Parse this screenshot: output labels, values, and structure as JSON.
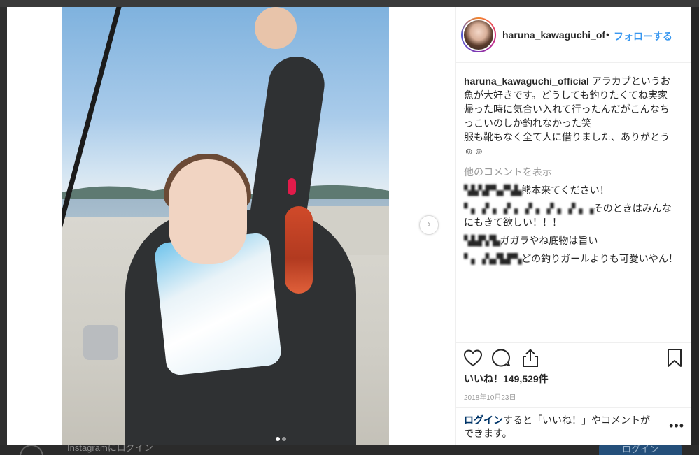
{
  "post": {
    "username": "haruna_kawaguchi_official",
    "username_truncated": "haruna_kawaguchi_offi",
    "separator": "•",
    "follow_label": "フォローする",
    "caption_user": "haruna_kawaguchi_official",
    "caption_lines": [
      "アラカブというお魚が大好きです。どうしても釣りたくてね実家帰った時に気合い入れて行ったんだがこんなちっこいのしか釣れなかった笑",
      "服も靴もなく全て人に借りました、ありがとう☺☺"
    ],
    "more_comments_label": "他のコメントを表示",
    "comments": [
      {
        "user": "▚▙▚▛▚▞▚▙",
        "text": "熊本来てください！"
      },
      {
        "user": "▘▖▗▘▖▗▘▖▗▘▖▗▘▖▗▘▖▗",
        "text": "そのときはみんなにもきて欲しい！！！"
      },
      {
        "user": "▚▙▛▞▙",
        "text": "ガガラやね底物は旨い"
      },
      {
        "user": "▘▖▗▚▞▙▛▚",
        "text": "どの釣りガールよりも可愛いやん！"
      }
    ],
    "likes_label": "いいね！149,529件",
    "date": "2018年10月23日",
    "login_link": "ログイン",
    "login_rest": "すると「いいね！」やコメントができます。",
    "more_menu": "•••",
    "carousel_next": "›"
  },
  "background": {
    "instagram_login_text": "Instagramにログイン",
    "login_button": "ログイン"
  },
  "icons": [
    "heart-icon",
    "comment-icon",
    "share-icon",
    "bookmark-icon",
    "chevron-right-icon",
    "more-icon"
  ],
  "colors": {
    "accent": "#3897f0",
    "text": "#262626",
    "muted": "#999999",
    "link": "#003569"
  }
}
